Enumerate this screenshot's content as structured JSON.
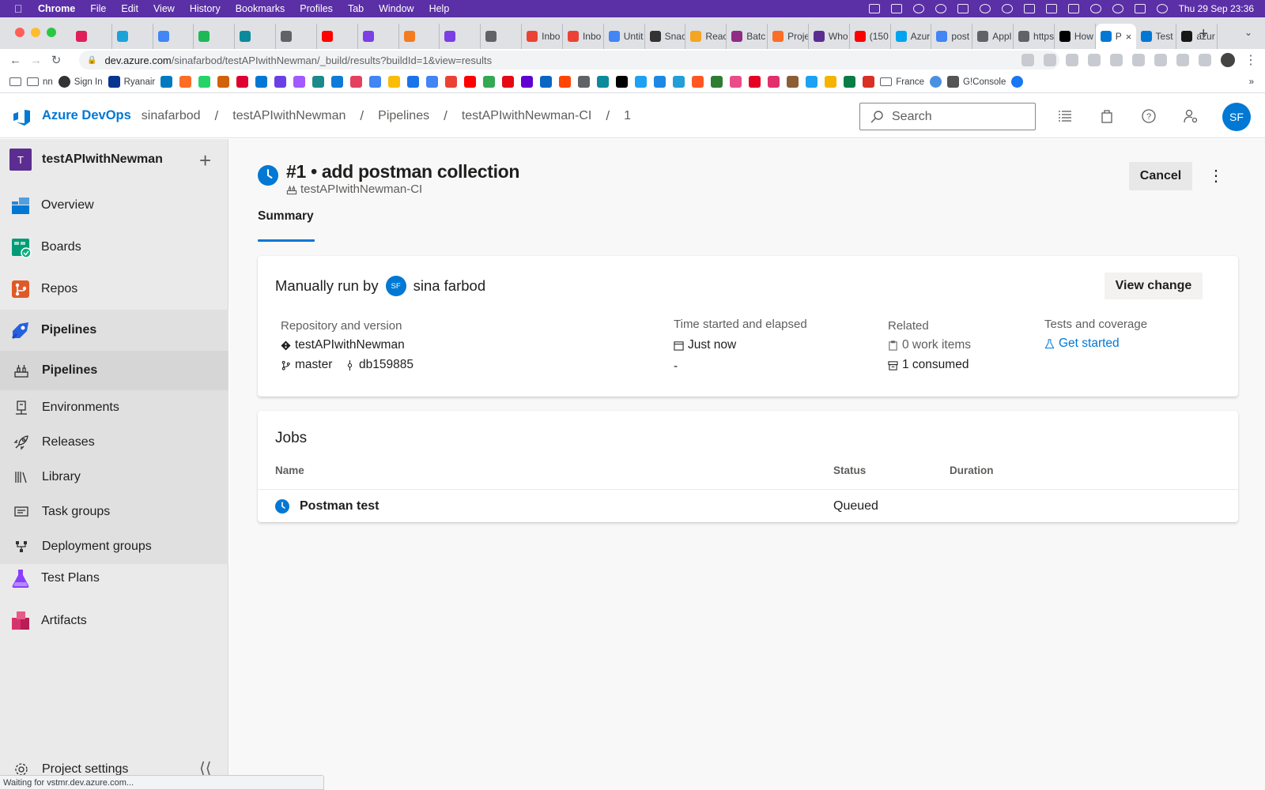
{
  "macos": {
    "app": "Chrome",
    "menus": [
      "File",
      "Edit",
      "View",
      "History",
      "Bookmarks",
      "Profiles",
      "Tab",
      "Window",
      "Help"
    ],
    "clock": "Thu 29 Sep  23:36"
  },
  "browser": {
    "tabs": [
      {
        "label": "",
        "color": "#e01e5a"
      },
      {
        "label": "",
        "color": "#1aa3d9"
      },
      {
        "label": "",
        "color": "#4285f4"
      },
      {
        "label": "",
        "color": "#1db954"
      },
      {
        "label": "",
        "color": "#0b8a9b"
      },
      {
        "label": "",
        "color": "#5f6368"
      },
      {
        "label": "",
        "color": "#ff0000"
      },
      {
        "label": "",
        "color": "#7b3fe4"
      },
      {
        "label": "",
        "color": "#f47c20"
      },
      {
        "label": "",
        "color": "#7b3fe4"
      },
      {
        "label": "",
        "color": "#5f6368"
      },
      {
        "label": "Inbo",
        "color": "#ea4335"
      },
      {
        "label": "Inbo",
        "color": "#ea4335"
      },
      {
        "label": "Untit",
        "color": "#4285f4"
      },
      {
        "label": "Snac",
        "color": "#333333"
      },
      {
        "label": "Reac",
        "color": "#f4a522"
      },
      {
        "label": "Batc",
        "color": "#8e2d83"
      },
      {
        "label": "Proje",
        "color": "#fc6d26"
      },
      {
        "label": "Who",
        "color": "#5c2d91"
      },
      {
        "label": "(150",
        "color": "#ff0000"
      },
      {
        "label": "Azur",
        "color": "#00a4ef"
      },
      {
        "label": "post",
        "color": "#4285f4"
      },
      {
        "label": "Appl",
        "color": "#5f6368"
      },
      {
        "label": "https",
        "color": "#5f6368"
      },
      {
        "label": "How",
        "color": "#000000"
      },
      {
        "label": "P",
        "color": "#0078d4"
      },
      {
        "label": "Test",
        "color": "#0078d4"
      },
      {
        "label": "azur",
        "color": "#181717"
      }
    ],
    "url_host": "dev.azure.com",
    "url_path": "/sinafarbod/testAPIwithNewman/_build/results?buildId=1&view=results",
    "bookmarks": [
      "nn",
      "Sign In",
      "Ryanair",
      "France",
      "G!Console"
    ],
    "status_tip": "Waiting for vstmr.dev.azure.com..."
  },
  "header": {
    "brand": "Azure DevOps",
    "breadcrumb": [
      "sinafarbod",
      "testAPIwithNewman",
      "Pipelines",
      "testAPIwithNewman-CI",
      "1"
    ],
    "search_placeholder": "Search",
    "user_initials": "SF"
  },
  "sidebar": {
    "project_initial": "T",
    "project_name": "testAPIwithNewman",
    "items": [
      {
        "label": "Overview"
      },
      {
        "label": "Boards"
      },
      {
        "label": "Repos"
      },
      {
        "label": "Pipelines"
      },
      {
        "label": "Pipelines"
      },
      {
        "label": "Environments"
      },
      {
        "label": "Releases"
      },
      {
        "label": "Library"
      },
      {
        "label": "Task groups"
      },
      {
        "label": "Deployment groups"
      },
      {
        "label": "Test Plans"
      },
      {
        "label": "Artifacts"
      }
    ],
    "settings_label": "Project settings"
  },
  "run": {
    "title": "#1 • add postman collection",
    "pipeline": "testAPIwithNewman-CI",
    "cancel_label": "Cancel",
    "tab_summary": "Summary",
    "manually_run_by": "Manually run by",
    "user_initials": "SF",
    "user_name": "sina farbod",
    "view_change_label": "View change",
    "repo_header": "Repository and version",
    "repo_name": "testAPIwithNewman",
    "branch": "master",
    "commit": "db159885",
    "time_header": "Time started and elapsed",
    "time_started": "Just now",
    "elapsed": "-",
    "related_header": "Related",
    "work_items": "0 work items",
    "consumed": "1 consumed",
    "tests_header": "Tests and coverage",
    "get_started": "Get started"
  },
  "jobs": {
    "title": "Jobs",
    "columns": [
      "Name",
      "Status",
      "Duration"
    ],
    "rows": [
      {
        "name": "Postman test",
        "status": "Queued",
        "duration": ""
      }
    ]
  },
  "colors": {
    "accent": "#0078d4",
    "menubar": "#5b2fa5",
    "project_tile": "#5c2d91"
  }
}
